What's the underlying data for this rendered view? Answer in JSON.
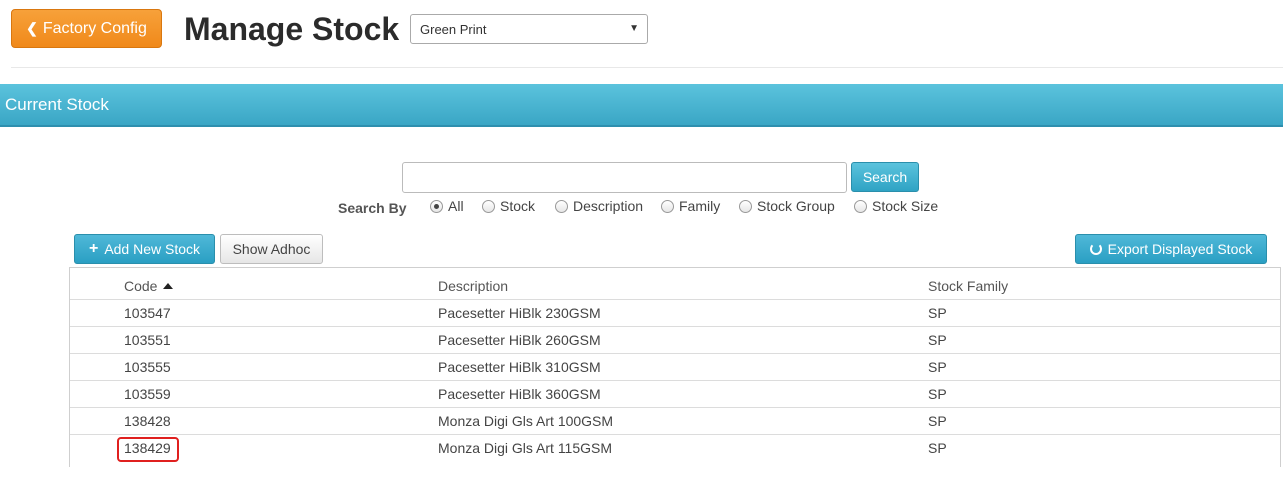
{
  "header": {
    "factory_button": "Factory Config",
    "title": "Manage Stock",
    "site_select": {
      "value": "Green Print"
    }
  },
  "panel": {
    "title": "Current Stock"
  },
  "search": {
    "input_value": "",
    "button": "Search",
    "by_label": "Search By",
    "options": [
      "All",
      "Stock",
      "Description",
      "Family",
      "Stock Group",
      "Stock Size"
    ],
    "selected": "All"
  },
  "actions": {
    "add_new": "Add New Stock",
    "show_adhoc": "Show Adhoc",
    "export": "Export Displayed Stock"
  },
  "table": {
    "columns": [
      "Code",
      "Description",
      "Stock Family"
    ],
    "sort_column": "Code",
    "sort_direction": "ascending",
    "rows": [
      {
        "code": "103547",
        "description": "Pacesetter HiBlk 230GSM",
        "family": "SP"
      },
      {
        "code": "103551",
        "description": "Pacesetter HiBlk 260GSM",
        "family": "SP"
      },
      {
        "code": "103555",
        "description": "Pacesetter HiBlk 310GSM",
        "family": "SP"
      },
      {
        "code": "103559",
        "description": "Pacesetter HiBlk 360GSM",
        "family": "SP"
      },
      {
        "code": "138428",
        "description": "Monza Digi Gls Art 100GSM",
        "family": "SP"
      },
      {
        "code": "138429",
        "description": "Monza Digi Gls Art 115GSM",
        "family": "SP"
      }
    ],
    "highlighted_code": "138429"
  },
  "colors": {
    "orange_button": "#f0891a",
    "primary_blue": "#2a9fc3",
    "highlight_red": "#e0201f"
  }
}
